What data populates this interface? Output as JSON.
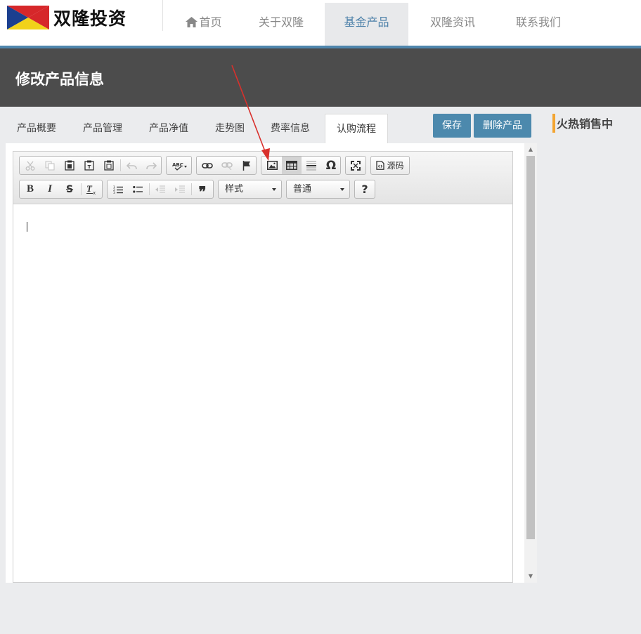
{
  "brand": {
    "name": "双隆投资"
  },
  "nav": {
    "items": [
      {
        "label": "首页",
        "icon": "home-icon"
      },
      {
        "label": "关于双隆"
      },
      {
        "label": "基金产品",
        "active": true
      },
      {
        "label": "双隆资讯"
      },
      {
        "label": "联系我们"
      }
    ]
  },
  "page": {
    "title": "修改产品信息"
  },
  "tabs": [
    {
      "label": "产品概要"
    },
    {
      "label": "产品管理"
    },
    {
      "label": "产品净值"
    },
    {
      "label": "走势图"
    },
    {
      "label": "费率信息"
    },
    {
      "label": "认购流程",
      "active": true
    }
  ],
  "actions": {
    "save_label": "保存",
    "delete_label": "删除产品"
  },
  "sidebar": {
    "hot_title": "火热销售中"
  },
  "editor": {
    "toolbar": {
      "row1": [
        "cut-icon",
        "copy-icon",
        "paste-icon",
        "paste-text-icon",
        "paste-word-icon",
        "undo-icon",
        "redo-icon",
        "spellcheck-icon",
        "link-icon",
        "unlink-icon",
        "anchor-icon",
        "image-icon",
        "table-icon",
        "horizontal-rule-icon",
        "special-char-icon",
        "maximize-icon"
      ],
      "source_label": "源码",
      "row2": [
        "bold-icon",
        "italic-icon",
        "strike-icon",
        "remove-format-icon",
        "numbered-list-icon",
        "bulleted-list-icon",
        "outdent-icon",
        "indent-icon",
        "blockquote-icon"
      ],
      "styles_label": "样式",
      "format_label": "普通",
      "help_label": "?"
    },
    "content": ""
  },
  "colors": {
    "accent": "#4c89ad",
    "header_bg": "#4c4c4c",
    "hot_marker": "#f3a531",
    "annotation_arrow": "#d9302c"
  }
}
